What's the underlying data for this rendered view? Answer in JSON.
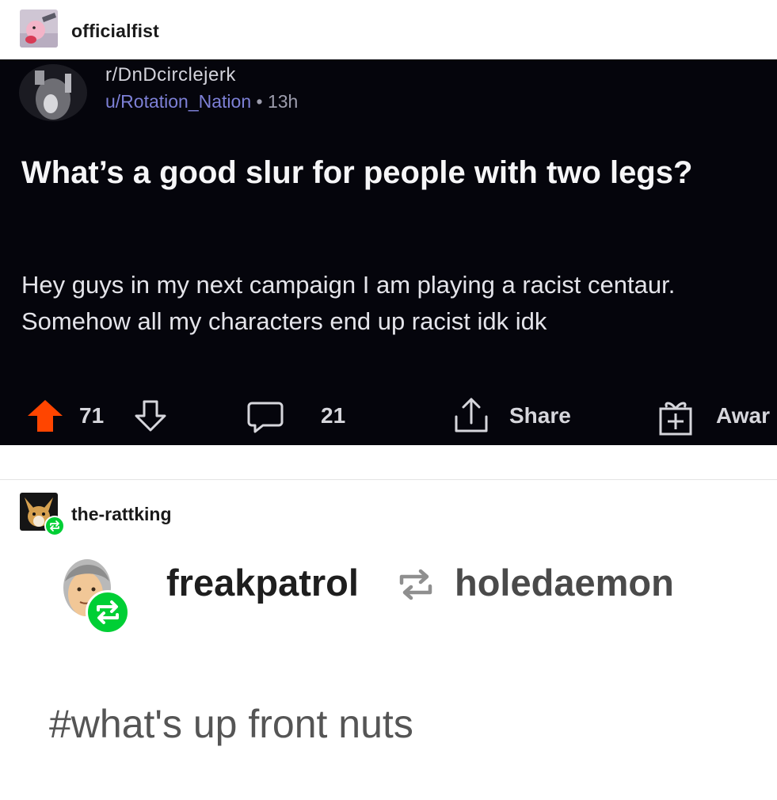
{
  "top_post": {
    "username": "officialfist"
  },
  "reddit": {
    "subreddit": "r/DnDcirclejerk",
    "user": "u/Rotation_Nation",
    "separator": "•",
    "age": "13h",
    "title": "What’s a good slur for people with two legs?",
    "body": "Hey guys in my next campaign I am playing a racist centaur. Somehow all my characters end up racist idk idk",
    "score": "71",
    "comments": "21",
    "share_label": "Share",
    "award_label": "Awar",
    "colors": {
      "background": "#05050c",
      "upvote": "#ff4500",
      "username": "#7d80d6"
    }
  },
  "reblogger": {
    "username": "the-rattking"
  },
  "trail": {
    "poster": "freakpatrol",
    "reblogged_from": "holedaemon",
    "tag": "#what's up front nuts"
  },
  "icons": [
    "avatar-officialfist",
    "avatar-subreddit",
    "upvote-icon",
    "downvote-icon",
    "comment-icon",
    "share-icon",
    "award-icon",
    "avatar-rattking",
    "reblog-badge-icon",
    "avatar-freakpatrol",
    "reblog-icon"
  ]
}
